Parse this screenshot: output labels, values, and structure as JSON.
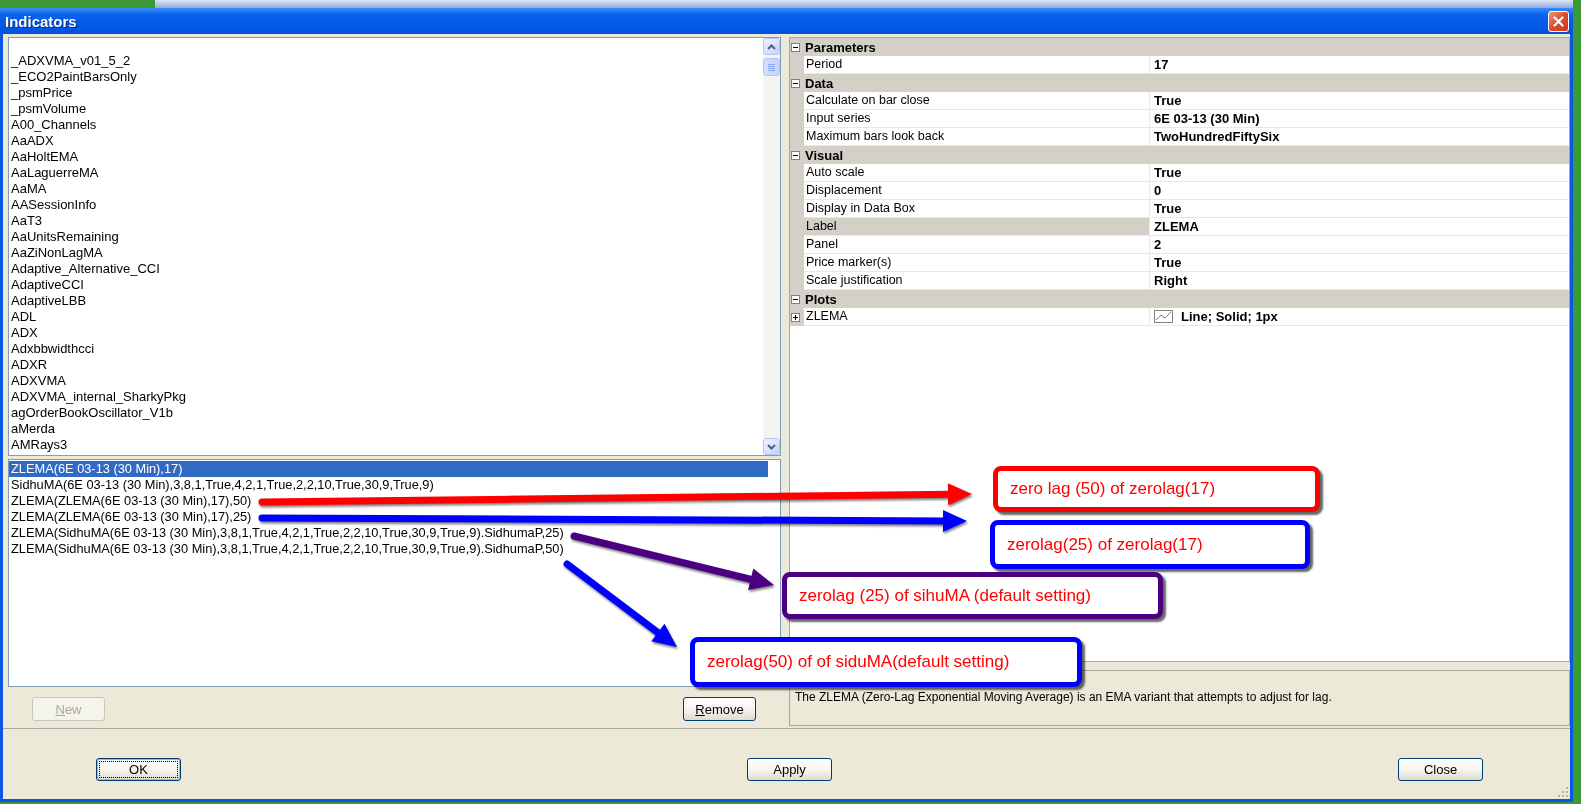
{
  "window": {
    "title": "Indicators"
  },
  "available_indicators": [
    {
      "name": "_ADXVMA_v01_5_2",
      "selected": false
    },
    {
      "name": "_ECO2PaintBarsOnly",
      "selected": false
    },
    {
      "name": "_psmPrice",
      "selected": false
    },
    {
      "name": "_psmVolume",
      "selected": false
    },
    {
      "name": "A00_Channels",
      "selected": false
    },
    {
      "name": "AaADX",
      "selected": false
    },
    {
      "name": "AaHoltEMA",
      "selected": false
    },
    {
      "name": "AaLaguerreMA",
      "selected": false
    },
    {
      "name": "AaMA",
      "selected": false
    },
    {
      "name": "AASessionInfo",
      "selected": false
    },
    {
      "name": "AaT3",
      "selected": false
    },
    {
      "name": "AaUnitsRemaining",
      "selected": false
    },
    {
      "name": "AaZiNonLagMA",
      "selected": false
    },
    {
      "name": "Adaptive_Alternative_CCI",
      "selected": false
    },
    {
      "name": "AdaptiveCCI",
      "selected": false
    },
    {
      "name": "AdaptiveLBB",
      "selected": false
    },
    {
      "name": "ADL",
      "selected": false
    },
    {
      "name": "ADX",
      "selected": false
    },
    {
      "name": "Adxbbwidthcci",
      "selected": false
    },
    {
      "name": "ADXR",
      "selected": false
    },
    {
      "name": "ADXVMA",
      "selected": false
    },
    {
      "name": "ADXVMA_internal_SharkyPkg",
      "selected": false
    },
    {
      "name": "agOrderBookOscillator_V1b",
      "selected": false
    },
    {
      "name": "aMerda",
      "selected": false
    },
    {
      "name": "AMRays3",
      "selected": false
    }
  ],
  "applied_indicators": [
    {
      "name": "ZLEMA(6E 03-13 (30 Min),17)",
      "selected": true
    },
    {
      "name": "SidhuMA(6E 03-13 (30 Min),3,8,1,True,4,2,1,True,2,2,10,True,30,9,True,9)",
      "selected": false
    },
    {
      "name": "ZLEMA(ZLEMA(6E 03-13 (30 Min),17),50)",
      "selected": false
    },
    {
      "name": "ZLEMA(ZLEMA(6E 03-13 (30 Min),17),25)",
      "selected": false
    },
    {
      "name": "ZLEMA(SidhuMA(6E 03-13 (30 Min),3,8,1,True,4,2,1,True,2,2,10,True,30,9,True,9).SidhumaP,25)",
      "selected": false
    },
    {
      "name": "ZLEMA(SidhuMA(6E 03-13 (30 Min),3,8,1,True,4,2,1,True,2,2,10,True,30,9,True,9).SidhumaP,50)",
      "selected": false
    }
  ],
  "list_buttons": [
    {
      "label": "New",
      "disabled": true,
      "mnemonic": true
    },
    {
      "label": "Remove",
      "disabled": false,
      "mnemonic": true
    }
  ],
  "property_grid": {
    "categories": [
      {
        "name": "Parameters",
        "expanded": true,
        "properties": [
          {
            "kind": "value",
            "label": "Period",
            "value": "17",
            "selected": false
          }
        ]
      },
      {
        "name": "Data",
        "expanded": true,
        "properties": [
          {
            "kind": "value",
            "label": "Calculate on bar close",
            "value": "True",
            "selected": false
          },
          {
            "kind": "value",
            "label": "Input series",
            "value": "6E 03-13 (30 Min)",
            "selected": false
          },
          {
            "kind": "value",
            "label": "Maximum bars look back",
            "value": "TwoHundredFiftySix",
            "selected": false
          }
        ]
      },
      {
        "name": "Visual",
        "expanded": true,
        "properties": [
          {
            "kind": "value",
            "label": "Auto scale",
            "value": "True",
            "selected": false
          },
          {
            "kind": "value",
            "label": "Displacement",
            "value": "0",
            "selected": false
          },
          {
            "kind": "value",
            "label": "Display in Data Box",
            "value": "True",
            "selected": false
          },
          {
            "kind": "value",
            "label": "Label",
            "value": "ZLEMA",
            "selected": true
          },
          {
            "kind": "value",
            "label": "Panel",
            "value": "2",
            "selected": false
          },
          {
            "kind": "value",
            "label": "Price marker(s)",
            "value": "True",
            "selected": false
          },
          {
            "kind": "value",
            "label": "Scale justification",
            "value": "Right",
            "selected": false
          }
        ]
      },
      {
        "name": "Plots",
        "expanded": true,
        "properties": [
          {
            "kind": "plot",
            "label": "ZLEMA",
            "value": "Line; Solid; 1px",
            "selected": false,
            "expanded": false
          }
        ]
      }
    ]
  },
  "description": "The ZLEMA (Zero-Lag Exponential Moving Average) is an EMA variant that attempts to adjust for lag.",
  "dialog_buttons": [
    {
      "label": "OK",
      "focused": true
    },
    {
      "label": "Apply",
      "focused": false
    },
    {
      "label": "Close",
      "focused": false
    }
  ],
  "annotations": [
    {
      "text": "zero lag (50) of zerolag(17)",
      "color": "#ff0000"
    },
    {
      "text": "zerolag(25) of zerolag(17)",
      "color": "#0000ff"
    },
    {
      "text": "zerolag (25) of sihuMA (default setting)",
      "color": "#4b0082"
    },
    {
      "text": "zerolag(50) of of siduMA(default setting)",
      "color": "#0000ff"
    }
  ]
}
